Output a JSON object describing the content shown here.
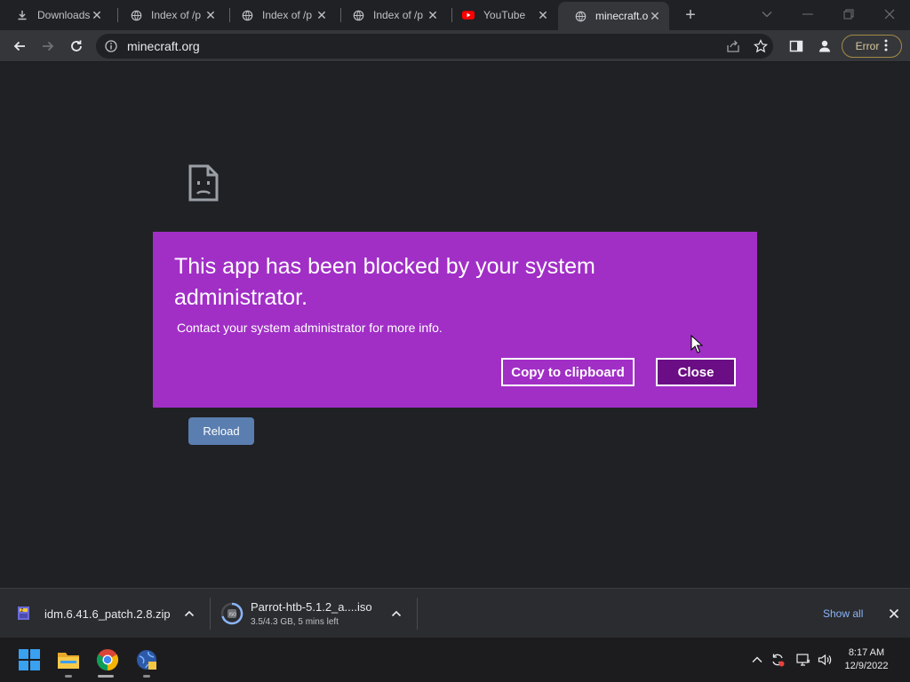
{
  "tabs": [
    {
      "label": "Downloads",
      "icon": "download-icon"
    },
    {
      "label": "Index of /p",
      "icon": "globe-icon"
    },
    {
      "label": "Index of /p",
      "icon": "globe-icon"
    },
    {
      "label": "Index of /p",
      "icon": "globe-icon"
    },
    {
      "label": "YouTube",
      "icon": "youtube-icon"
    },
    {
      "label": "minecraft.o",
      "icon": "globe-icon",
      "active": true
    }
  ],
  "toolbar": {
    "url": "minecraft.org",
    "error_label": "Error"
  },
  "page": {
    "reload_label": "Reload"
  },
  "dialog": {
    "title": "This app has been blocked by your system administrator.",
    "message": "Contact your system administrator for more info.",
    "copy_label": "Copy to clipboard",
    "close_label": "Close",
    "accent": "#a12fc6"
  },
  "downloads": {
    "items": [
      {
        "name": "idm.6.41.6_patch.2.8.zip",
        "status": ""
      },
      {
        "name": "Parrot-htb-5.1.2_a....iso",
        "status": "3.5/4.3 GB, 5 mins left"
      }
    ],
    "show_all": "Show all"
  },
  "taskbar": {
    "time": "8:17 AM",
    "date": "12/9/2022"
  }
}
